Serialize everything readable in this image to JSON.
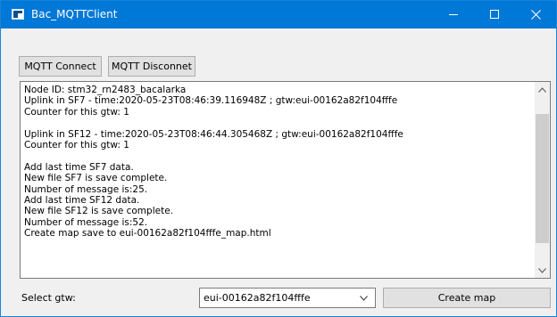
{
  "window": {
    "title": "Bac_MQTTClient"
  },
  "toolbar": {
    "connect_label": "MQTT Connect",
    "disconnect_label": "MQTT Disconnet"
  },
  "log": {
    "lines": [
      "Node ID: stm32_rn2483_bacalarka",
      "Uplink in SF7 - time:2020-05-23T08:46:39.116948Z ; gtw:eui-00162a82f104fffe",
      "Counter for this gtw: 1",
      "",
      "Uplink in SF12 - time:2020-05-23T08:46:44.305468Z ; gtw:eui-00162a82f104fffe",
      "Counter for this gtw: 1",
      "",
      "Add last time SF7 data.",
      "New file SF7 is save complete.",
      "Number of message is:25.",
      "Add last time SF12 data.",
      "New file SF12 is save complete.",
      "Number of message is:52.",
      "Create map save to eui-00162a82f104fffe_map.html"
    ]
  },
  "bottom": {
    "select_label": "Select gtw:",
    "selected_gtw": "eui-00162a82f104fffe",
    "create_map_label": "Create map"
  },
  "icons": {
    "app": "app-icon",
    "minimize": "minimize-icon",
    "maximize": "maximize-icon",
    "close": "close-icon",
    "scroll_up": "scroll-up-icon",
    "scroll_down": "scroll-down-icon",
    "dropdown": "chevron-down-icon"
  },
  "colors": {
    "titlebar": "#0078d7",
    "window_bg": "#f0f0f0",
    "button_bg": "#e1e1e1"
  }
}
